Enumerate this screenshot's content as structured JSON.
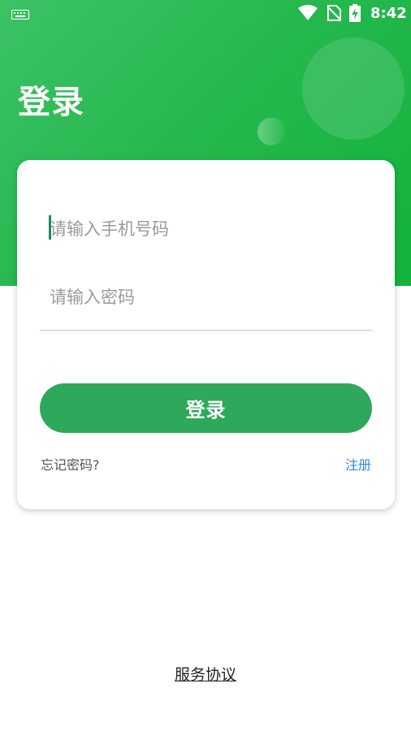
{
  "status_bar": {
    "time": "8:42",
    "icons": [
      "keyboard-icon",
      "wifi-icon",
      "no-sim-icon",
      "battery-charging-icon"
    ]
  },
  "header": {
    "title": "登录"
  },
  "form": {
    "phone": {
      "placeholder": "请输入手机号码",
      "value": ""
    },
    "password": {
      "placeholder": "请输入密码",
      "value": ""
    },
    "login_label": "登录",
    "forgot_label": "忘记密码?",
    "register_label": "注册"
  },
  "footer": {
    "agreement_label": "服务协议"
  },
  "colors": {
    "primary": "#2ea85a",
    "header_green": "#26b84f",
    "link_blue": "#2d8ae0"
  }
}
